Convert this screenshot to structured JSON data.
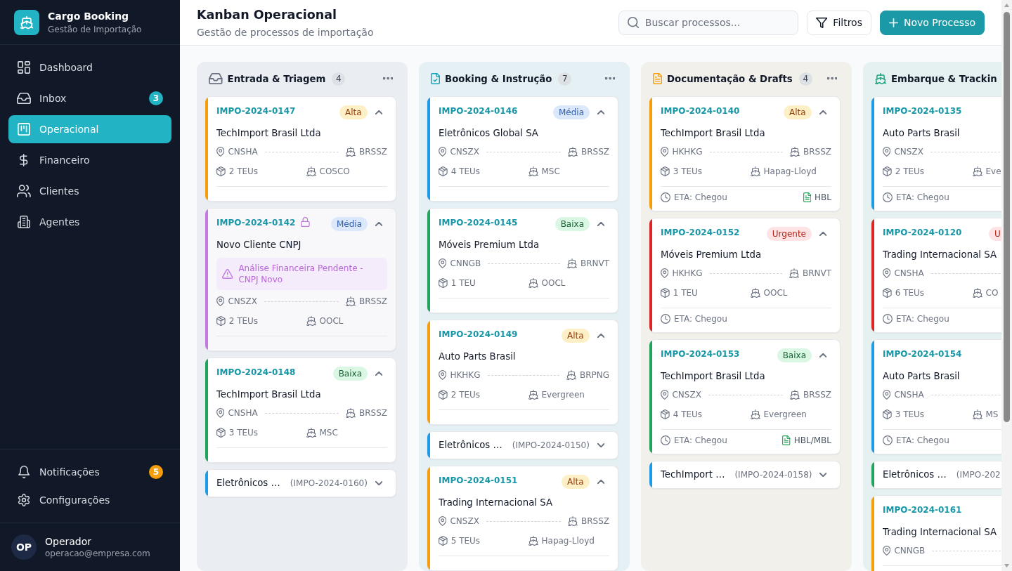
{
  "sidebar": {
    "brand": {
      "title": "Cargo Booking",
      "subtitle": "Gestão de Importação"
    },
    "nav": [
      {
        "label": "Dashboard",
        "kind": "dashboard",
        "selected": false
      },
      {
        "label": "Inbox",
        "kind": "inbox",
        "selected": false,
        "badge": {
          "text": "3",
          "color": "#22b3c5"
        }
      },
      {
        "label": "Operacional",
        "kind": "kanban",
        "selected": true
      },
      {
        "label": "Financeiro",
        "kind": "finance",
        "selected": false
      },
      {
        "label": "Clientes",
        "kind": "clients",
        "selected": false
      },
      {
        "label": "Agentes",
        "kind": "agents",
        "selected": false
      }
    ],
    "footer_nav": [
      {
        "label": "Notificações",
        "kind": "bell",
        "selected": false,
        "badge": {
          "text": "5",
          "color": "#f59e0b"
        }
      },
      {
        "label": "Configurações",
        "kind": "settings",
        "selected": false
      }
    ],
    "user": {
      "initials": "OP",
      "name": "Operador",
      "email": "operacao@empresa.com"
    }
  },
  "header": {
    "title": "Kanban Operacional",
    "subtitle": "Gestão de processos de importação",
    "search": {
      "placeholder": "Buscar processos..."
    },
    "buttons": [
      {
        "label": "Filtros",
        "kind": "filter"
      },
      {
        "label": "Novo Processo",
        "kind": "primary"
      }
    ]
  },
  "board": {
    "columns": [
      {
        "title": "Entrada & Triagem",
        "kind": "inbox",
        "color": "#6b7280",
        "count": "4",
        "cards": [
          {
            "process": "IMPO-2024-0147",
            "expanded": true,
            "locked": false,
            "color": "#f59e0b",
            "priority": {
              "label": "Alta",
              "kind": "high"
            },
            "company": "TechImport Brasil Ltda",
            "origin": "CNSHA",
            "destination": "BRSSZ",
            "teus": "2 TEUs",
            "carrier": "COSCO"
          },
          {
            "process": "IMPO-2024-0142",
            "expanded": true,
            "locked": true,
            "color": "#c27ae0",
            "priority": {
              "label": "Média",
              "kind": "medium"
            },
            "company": "Novo Cliente CNPJ",
            "alert": "Análise Financeira Pendente - CNPJ Novo",
            "origin": "CNSZX",
            "destination": "BRSSZ",
            "teus": "2 TEUs",
            "carrier": "OOCL"
          },
          {
            "process": "IMPO-2024-0148",
            "expanded": true,
            "locked": false,
            "color": "#22a35a",
            "priority": {
              "label": "Baixa",
              "kind": "low"
            },
            "company": "TechImport Brasil Ltda",
            "origin": "CNSHA",
            "destination": "BRSSZ",
            "teus": "3 TEUs",
            "carrier": "MSC"
          },
          {
            "process": "(IMPO-2024-0160)",
            "expanded": false,
            "locked": false,
            "color": "#1d9be6",
            "company": "Eletrônicos …"
          }
        ]
      },
      {
        "title": "Booking & Instrução",
        "kind": "booking",
        "color": "#14a3b8",
        "count": "7",
        "cards": [
          {
            "process": "IMPO-2024-0146",
            "expanded": true,
            "locked": false,
            "color": "#1d9be6",
            "priority": {
              "label": "Média",
              "kind": "medium"
            },
            "company": "Eletrônicos Global SA",
            "origin": "CNSZX",
            "destination": "BRSSZ",
            "teus": "4 TEUs",
            "carrier": "MSC"
          },
          {
            "process": "IMPO-2024-0145",
            "expanded": true,
            "locked": false,
            "color": "#22a35a",
            "priority": {
              "label": "Baixa",
              "kind": "low"
            },
            "company": "Móveis Premium Ltda",
            "origin": "CNNGB",
            "destination": "BRNVT",
            "teus": "1 TEU",
            "carrier": "OOCL"
          },
          {
            "process": "IMPO-2024-0149",
            "expanded": true,
            "locked": false,
            "color": "#f59e0b",
            "priority": {
              "label": "Alta",
              "kind": "high"
            },
            "company": "Auto Parts Brasil",
            "origin": "HKHKG",
            "destination": "BRPNG",
            "teus": "2 TEUs",
            "carrier": "Evergreen"
          },
          {
            "process": "(IMPO-2024-0150)",
            "expanded": false,
            "locked": false,
            "color": "#1d9be6",
            "company": "Eletrônicos …"
          },
          {
            "process": "IMPO-2024-0151",
            "expanded": true,
            "locked": false,
            "color": "#f59e0b",
            "priority": {
              "label": "Alta",
              "kind": "high"
            },
            "company": "Trading Internacional SA",
            "origin": "CNSZX",
            "destination": "BRSSZ",
            "teus": "5 TEUs",
            "carrier": "Hapag-Lloyd"
          }
        ]
      },
      {
        "title": "Documentação & Drafts",
        "kind": "docs",
        "color": "#f59e0b",
        "count": "4",
        "cards": [
          {
            "process": "IMPO-2024-0140",
            "expanded": true,
            "locked": false,
            "color": "#f59e0b",
            "priority": {
              "label": "Alta",
              "kind": "high"
            },
            "company": "TechImport Brasil Ltda",
            "origin": "HKHKG",
            "destination": "BRSSZ",
            "teus": "3 TEUs",
            "carrier": "Hapag-Lloyd",
            "eta": "ETA: Chegou",
            "document": "HBL"
          },
          {
            "process": "IMPO-2024-0152",
            "expanded": true,
            "locked": false,
            "color": "#dc2626",
            "priority": {
              "label": "Urgente",
              "kind": "urgent"
            },
            "company": "Móveis Premium Ltda",
            "origin": "HKHKG",
            "destination": "BRNVT",
            "teus": "1 TEU",
            "carrier": "OOCL",
            "eta": "ETA: Chegou"
          },
          {
            "process": "IMPO-2024-0153",
            "expanded": true,
            "locked": false,
            "color": "#22a35a",
            "priority": {
              "label": "Baixa",
              "kind": "low"
            },
            "company": "TechImport Brasil Ltda",
            "origin": "CNSZX",
            "destination": "BRSSZ",
            "teus": "4 TEUs",
            "carrier": "Evergreen",
            "eta": "ETA: Chegou",
            "document": "HBL/MBL"
          },
          {
            "process": "(IMPO-2024-0158)",
            "expanded": false,
            "locked": false,
            "color": "#1d9be6",
            "company": "TechImport …"
          }
        ]
      },
      {
        "title": "Embarque & Trackin",
        "kind": "shipping",
        "color": "#12a07a",
        "cards": [
          {
            "process": "IMPO-2024-0135",
            "expanded": true,
            "locked": false,
            "color": "#1d9be6",
            "company": "Auto Parts Brasil",
            "origin": "CNSZX",
            "teus": "2 TEUs",
            "carrier": "Eve",
            "eta": "ETA: Chegou"
          },
          {
            "process": "IMPO-2024-0120",
            "expanded": true,
            "locked": false,
            "color": "#dc2626",
            "priority": {
              "label": "U",
              "kind": "urgent"
            },
            "company": "Trading Internacional SA",
            "origin": "CNSHA",
            "teus": "6 TEUs",
            "carrier": "CO",
            "eta": "ETA: Chegou"
          },
          {
            "process": "IMPO-2024-0154",
            "expanded": true,
            "locked": false,
            "color": "#1d9be6",
            "company": "Auto Parts Brasil",
            "origin": "CNSHA",
            "teus": "3 TEUs",
            "carrier": "MS",
            "eta": "ETA: Chegou"
          },
          {
            "process": "(IMPO-202",
            "expanded": false,
            "locked": false,
            "color": "#22a35a",
            "company": "Eletrônicos …"
          },
          {
            "process": "IMPO-2024-0161",
            "expanded": true,
            "locked": false,
            "color": "#f59e0b",
            "company": "Trading Internacional SA",
            "origin": "CNNGB"
          }
        ]
      }
    ]
  }
}
